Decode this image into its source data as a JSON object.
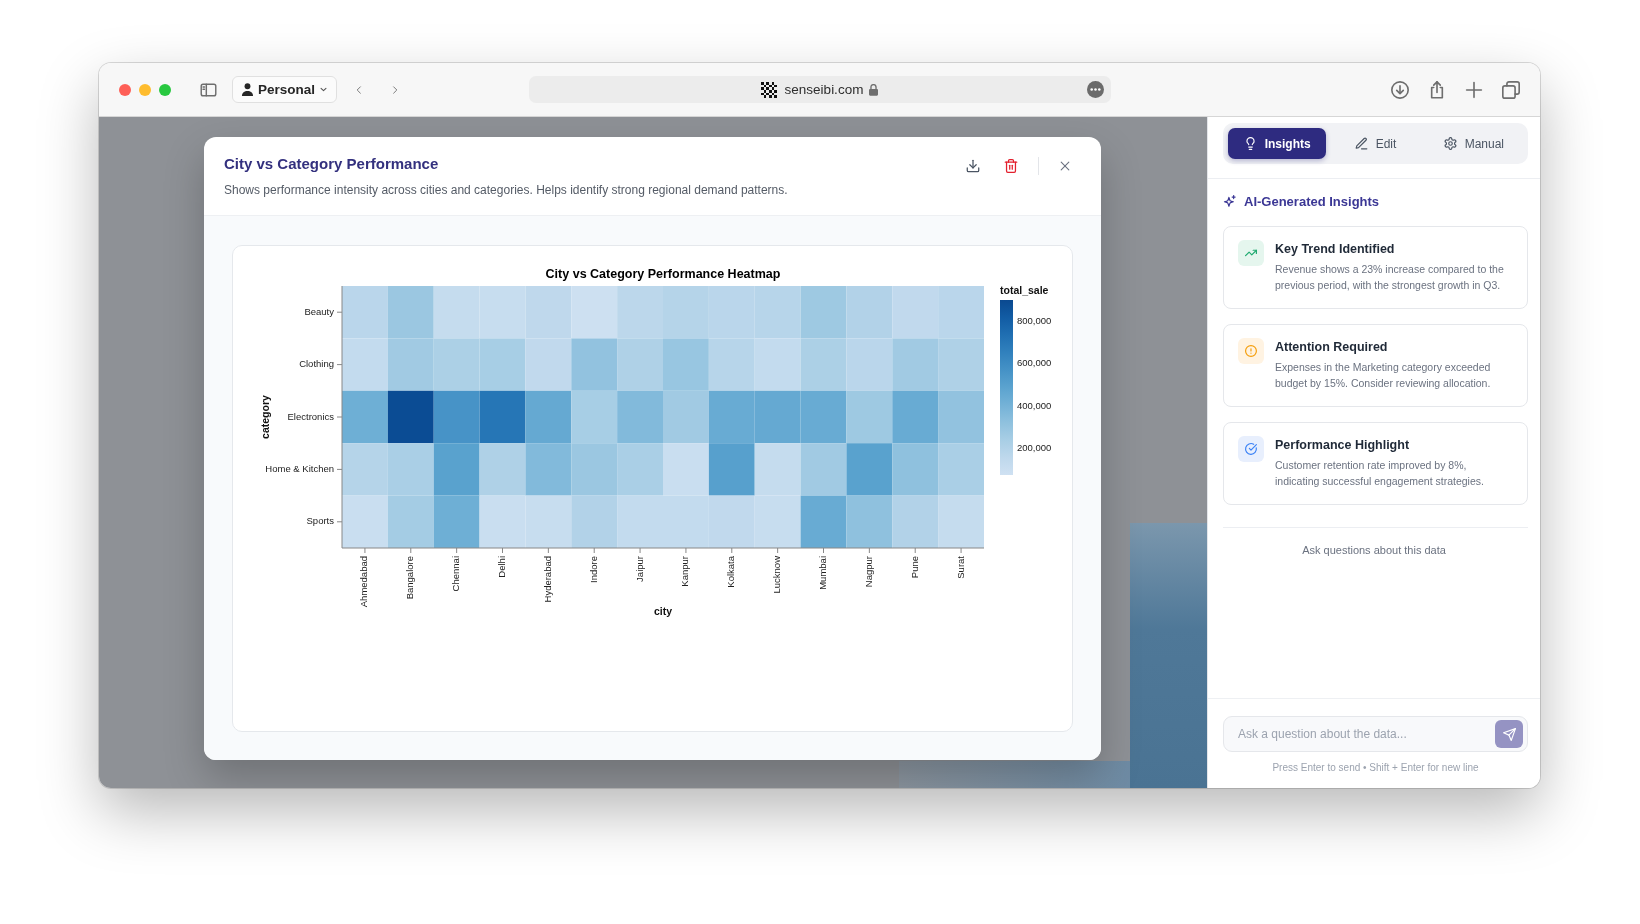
{
  "browser": {
    "profile": "Personal",
    "address": "senseibi.com"
  },
  "modal": {
    "title": "City vs Category Performance",
    "description": "Shows performance intensity across cities and categories. Helps identify strong regional demand patterns.",
    "heatmap": {
      "title": "City vs Category Performance Heatmap",
      "xlabel": "city",
      "ylabel": "category",
      "columns": [
        "Ahmedabad",
        "Bangalore",
        "Chennai",
        "Delhi",
        "Hyderabad",
        "Indore",
        "Jaipur",
        "Kanpur",
        "Kolkata",
        "Lucknow",
        "Mumbai",
        "Nagpur",
        "Pune",
        "Surat"
      ],
      "rows": [
        {
          "label": "Beauty",
          "cells": [
            {
              "color": "#bad6eb"
            },
            {
              "color": "#9bc7e1"
            },
            {
              "color": "#c5dcee"
            },
            {
              "color": "#c7ddef"
            },
            {
              "color": "#bfd8ec"
            },
            {
              "color": "#cde0f1"
            },
            {
              "color": "#bcd7eb"
            },
            {
              "color": "#b5d4e9"
            },
            {
              "color": "#bad6eb"
            },
            {
              "color": "#b7d5ea"
            },
            {
              "color": "#9ec9e2"
            },
            {
              "color": "#b2d2e8"
            },
            {
              "color": "#c1d9ed"
            },
            {
              "color": "#bad6eb"
            }
          ]
        },
        {
          "label": "Clothing",
          "cells": [
            {
              "color": "#c3dbee"
            },
            {
              "color": "#a1cae3"
            },
            {
              "color": "#acd0e6"
            },
            {
              "color": "#a7cee5"
            },
            {
              "color": "#c1d9ed"
            },
            {
              "color": "#92c2df"
            },
            {
              "color": "#afd1e7"
            },
            {
              "color": "#98c6e1"
            },
            {
              "color": "#b7d5ea"
            },
            {
              "color": "#c3dbee"
            },
            {
              "color": "#acd0e6"
            },
            {
              "color": "#bad6eb"
            },
            {
              "color": "#a1cae3"
            },
            {
              "color": "#afd1e7"
            }
          ]
        },
        {
          "label": "Electronics",
          "cells": [
            {
              "color": "#6eafd5"
            },
            {
              "color": "#0b4c94"
            },
            {
              "color": "#4793c7"
            },
            {
              "color": "#2676b6"
            },
            {
              "color": "#65a9d2"
            },
            {
              "color": "#a7cee5"
            },
            {
              "color": "#82badb"
            },
            {
              "color": "#a1cae3"
            },
            {
              "color": "#68abd3"
            },
            {
              "color": "#65a9d2"
            },
            {
              "color": "#68abd3"
            },
            {
              "color": "#9ec9e2"
            },
            {
              "color": "#68abd3"
            },
            {
              "color": "#92c2df"
            }
          ]
        },
        {
          "label": "Home & Kitchen",
          "cells": [
            {
              "color": "#b5d4e9"
            },
            {
              "color": "#aacfe6"
            },
            {
              "color": "#59a2ce"
            },
            {
              "color": "#afd1e7"
            },
            {
              "color": "#82badb"
            },
            {
              "color": "#9bc7e1"
            },
            {
              "color": "#aacfe6"
            },
            {
              "color": "#c9def0"
            },
            {
              "color": "#57a0cd"
            },
            {
              "color": "#c5dcee"
            },
            {
              "color": "#a1cae3"
            },
            {
              "color": "#59a2ce"
            },
            {
              "color": "#8fc1de"
            },
            {
              "color": "#aacfe6"
            }
          ]
        },
        {
          "label": "Sports",
          "cells": [
            {
              "color": "#c9def0"
            },
            {
              "color": "#a4cce4"
            },
            {
              "color": "#6eafd5"
            },
            {
              "color": "#c9def0"
            },
            {
              "color": "#c7ddef"
            },
            {
              "color": "#b2d2e8"
            },
            {
              "color": "#c3dbee"
            },
            {
              "color": "#c3dbee"
            },
            {
              "color": "#c1d9ed"
            },
            {
              "color": "#c7ddef"
            },
            {
              "color": "#68abd3"
            },
            {
              "color": "#8fc1de"
            },
            {
              "color": "#b2d2e8"
            },
            {
              "color": "#c5dcee"
            }
          ]
        }
      ],
      "legend": {
        "title": "total_sale",
        "ticks": [
          "800,000",
          "600,000",
          "400,000",
          "200,000"
        ]
      }
    }
  },
  "side_panel": {
    "tabs": [
      {
        "kind": "insights",
        "label": "Insights",
        "selected": true
      },
      {
        "kind": "edit",
        "label": "Edit",
        "selected": false
      },
      {
        "kind": "manual",
        "label": "Manual",
        "selected": false
      }
    ],
    "section_title": "AI-Generated Insights",
    "insights": [
      {
        "kind": "trend",
        "title": "Key Trend Identified",
        "text": "Revenue shows a 23% increase compared to the previous period, with the strongest growth in Q3."
      },
      {
        "kind": "warning",
        "title": "Attention Required",
        "text": "Expenses in the Marketing category exceeded budget by 15%. Consider reviewing allocation."
      },
      {
        "kind": "check",
        "title": "Performance Highlight",
        "text": "Customer retention rate improved by 8%, indicating successful engagement strategies."
      }
    ],
    "empty_state": "Ask questions about this data",
    "chat_input": {
      "placeholder": "Ask a question about the data..."
    },
    "send_button": {
      "disabled": true
    },
    "hint": "Press Enter to send • Shift + Enter for new line"
  }
}
